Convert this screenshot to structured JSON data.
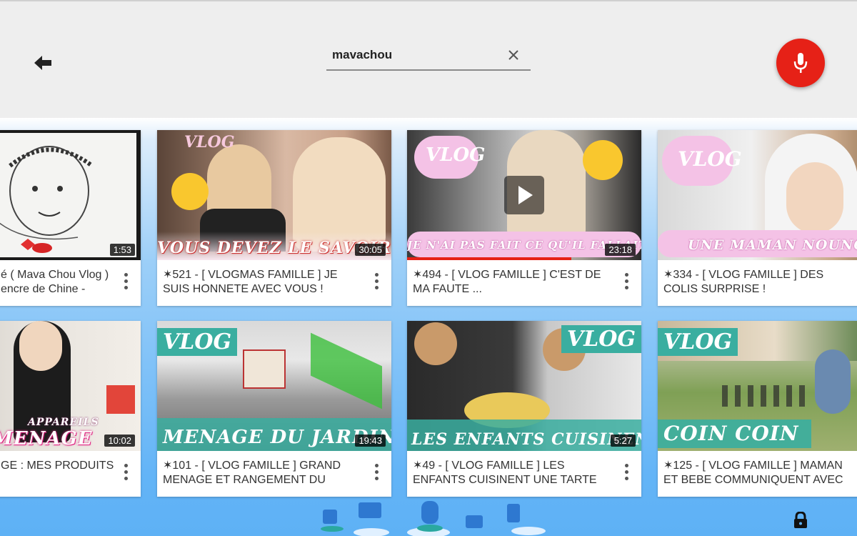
{
  "search": {
    "value": "mavachou",
    "placeholder": ""
  },
  "colors": {
    "mic": "#e62117",
    "background_top": "#eeeeee",
    "background_bottom": "#5eb1f5"
  },
  "icons": {
    "back": "arrow-back-icon",
    "clear": "close-icon",
    "mic": "microphone-icon",
    "more": "more-vert-icon",
    "lock": "lock-icon"
  },
  "videos": [
    {
      "title": "é ( Mava Chou Vlog )\nencre de Chine -",
      "duration": "1:53",
      "overlay": ""
    },
    {
      "title": "✶521 - [ VLOGMAS FAMILLE ] JE SUIS HONNETE AVEC VOUS !",
      "duration": "30:05",
      "overlay": "VOUS DEVEZ LE SAVOIR",
      "tag": "VLOG"
    },
    {
      "title": "✶494 - [ VLOG FAMILLE ] C'EST DE MA FAUTE ...",
      "duration": "23:18",
      "overlay": "JE N'AI PAS FAIT CE QU'IL FALLAIT",
      "tag": "VLOG",
      "progress": 0.7
    },
    {
      "title": "✶334 - [ VLOG FAMILLE ] DES COLIS SURPRISE !",
      "duration": "",
      "overlay": "UNE MAMAN NOUNOU",
      "tag": "VLOG"
    },
    {
      "title": "GE : MES PRODUITS",
      "duration": "10:02",
      "overlay": "MENAGE",
      "small_overlay": "APPAREILS"
    },
    {
      "title": "✶101 - [ VLOG FAMILLE ] GRAND MENAGE ET RANGEMENT DU",
      "duration": "19:43",
      "overlay": "MENAGE DU JARDIN",
      "tag": "VLOG"
    },
    {
      "title": "✶49 - [ VLOG FAMILLE ] LES ENFANTS CUISINENT UNE TARTE",
      "duration": "5:27",
      "overlay": "LES ENFANTS CUISINENT",
      "tag": "VLOG"
    },
    {
      "title": "✶125 - [ VLOG FAMILLE ] MAMAN ET BEBE COMMUNIQUENT AVEC",
      "duration": "",
      "overlay": "COIN COIN",
      "tag": "VLOG"
    }
  ]
}
